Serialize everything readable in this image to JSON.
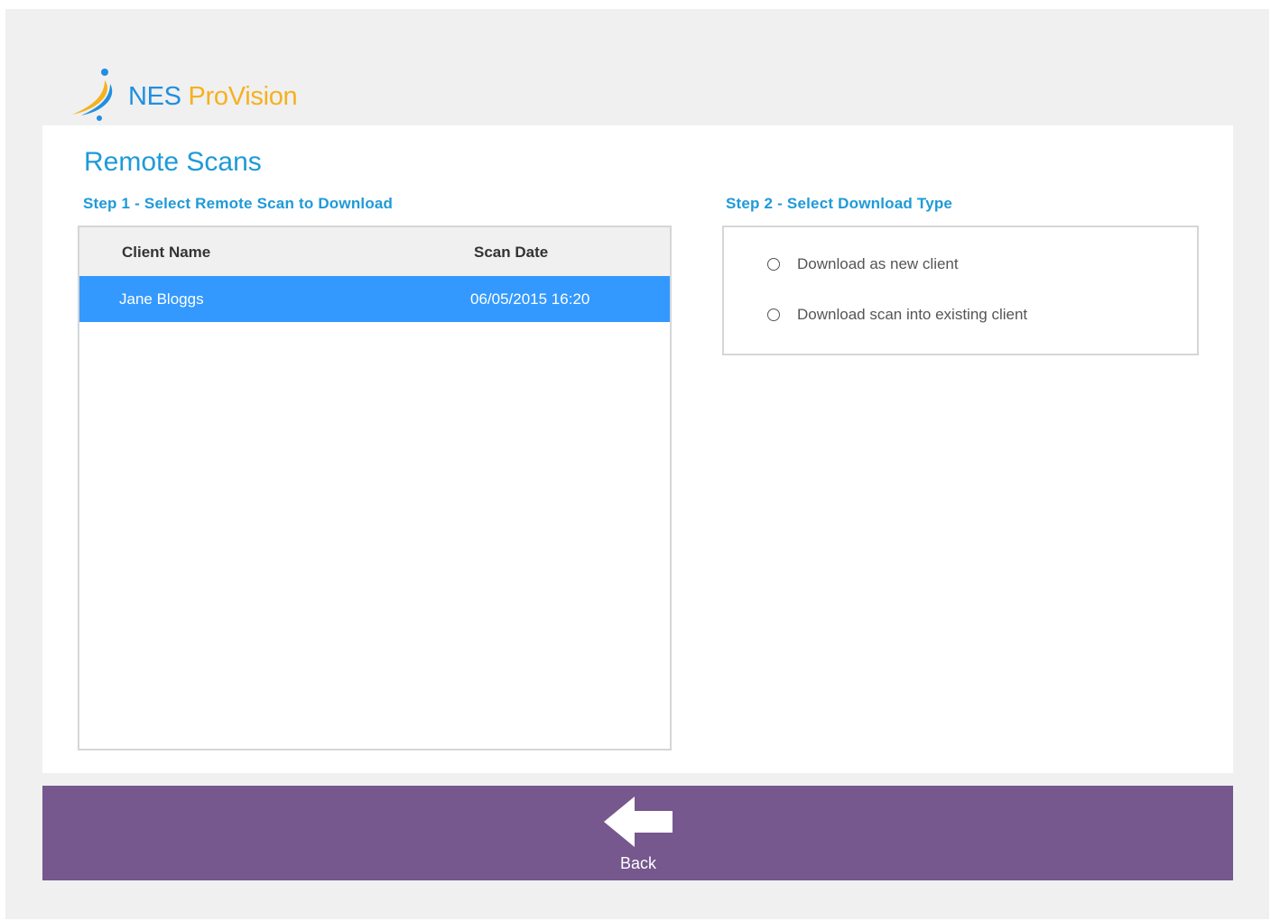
{
  "brand": {
    "name_part1": "NES",
    "name_part2": "ProVision",
    "color_primary": "#1f8fe0",
    "color_secondary": "#f5b120"
  },
  "page": {
    "title": "Remote Scans"
  },
  "step1": {
    "label": "Step 1 - Select Remote Scan to Download",
    "columns": [
      "Client Name",
      "Scan Date"
    ],
    "rows": [
      {
        "client_name": "Jane Bloggs",
        "scan_date": "06/05/2015 16:20",
        "selected": true
      }
    ]
  },
  "step2": {
    "label": "Step 2 - Select Download Type",
    "options": [
      {
        "label": "Download as new client",
        "checked": false
      },
      {
        "label": "Download scan into existing client",
        "checked": false
      }
    ]
  },
  "footer": {
    "back_label": "Back",
    "back_icon": "arrow-left-icon",
    "background_color": "#76578e"
  },
  "colors": {
    "accent": "#1e9ad8",
    "selection": "#3399ff"
  }
}
